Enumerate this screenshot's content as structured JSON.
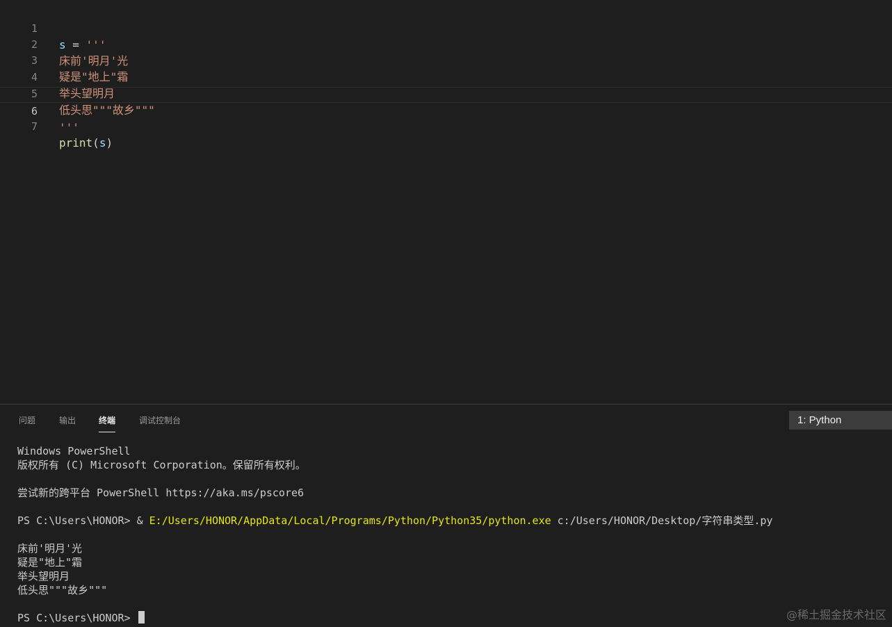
{
  "editor": {
    "lines": [
      {
        "num": "1",
        "parts": {
          "var": "s",
          "op": " = ",
          "str": "'''"
        }
      },
      {
        "num": "2",
        "text": "床前'明月'光"
      },
      {
        "num": "3",
        "text": "疑是\"地上\"霜"
      },
      {
        "num": "4",
        "text": "举头望明月"
      },
      {
        "num": "5",
        "text": "低头思\"\"\"故乡\"\"\""
      },
      {
        "num": "6",
        "text": "'''"
      },
      {
        "num": "7",
        "parts": {
          "fn": "print",
          "open": "(",
          "arg": "s",
          "close": ")"
        }
      }
    ]
  },
  "panel": {
    "tabs": [
      "问题",
      "输出",
      "终端",
      "调试控制台"
    ],
    "active_tab": "终端",
    "terminal_select": "1: Python",
    "terminal": {
      "line1": "Windows PowerShell",
      "line2": "版权所有 (C) Microsoft Corporation。保留所有权利。",
      "line3": "尝试新的跨平台 PowerShell https://aka.ms/pscore6",
      "cmd_prompt": "PS C:\\Users\\HONOR> & ",
      "cmd_exe": "E:/Users/HONOR/AppData/Local/Programs/Python/Python35/python.exe",
      "cmd_arg": " c:/Users/HONOR/Desktop/字符串类型.py",
      "out1": "床前'明月'光",
      "out2": "疑是\"地上\"霜",
      "out3": "举头望明月",
      "out4": "低头思\"\"\"故乡\"\"\"",
      "final_prompt": "PS C:\\Users\\HONOR> "
    }
  },
  "watermark": "@稀土掘金技术社区",
  "colors": {
    "background": "#1e1e1e",
    "string": "#ce9178",
    "variable": "#9cdcfe",
    "function": "#dcdcaa",
    "path_highlight": "#e5e510"
  }
}
